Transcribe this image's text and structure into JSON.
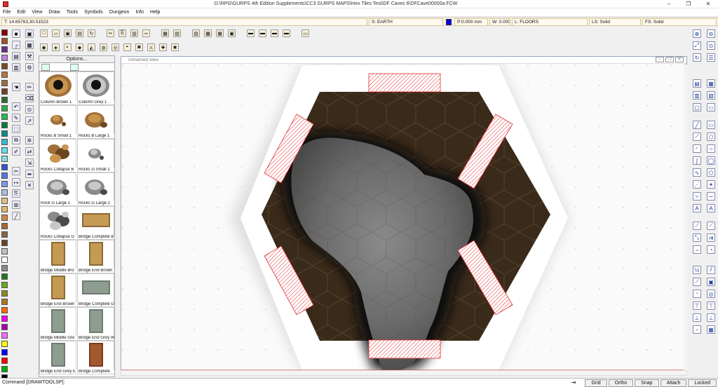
{
  "window": {
    "title": "D:\\RPG\\GURPS 4th Edition Supplements\\CC3 GURPS MAPS\\Hex Tiles Test\\DF Caves 6\\DFCave00000a.FCW",
    "controls": [
      "–",
      "❐",
      "✕"
    ]
  },
  "menu": [
    "File",
    "Edit",
    "View",
    "Draw",
    "Tools",
    "Symbols",
    "Dungeon",
    "Info",
    "Help"
  ],
  "status": {
    "coords": "T: 14.65763,30.51523",
    "sheet": "S: EARTH",
    "pen": "P:0.000 mm",
    "width": "W: 0.00000",
    "layer": "L: FLOORS",
    "line_style": "LS: Solid",
    "fill_style": "FS: Solid",
    "color": "#0000ff"
  },
  "palette": [
    "#8b0000",
    "#a0522d",
    "#6b2e8a",
    "#c080e0",
    "#7a4a22",
    "#b87340",
    "#9a6a40",
    "#704020",
    "#2e6b2e",
    "#33aa44",
    "#22bb55",
    "#0b7a3a",
    "#0c8a8a",
    "#33bbcc",
    "#66ddee",
    "#88e0e0",
    "#3355cc",
    "#5577dd",
    "#7799ee",
    "#a7c0e0",
    "#e0c080",
    "#ddbb66",
    "#cc8844",
    "#aa6633",
    "#886644",
    "#664422",
    "#c0c0c0",
    "#ffffff",
    "#888888",
    "#1a7a1a",
    "#66aa22",
    "#8a8a22",
    "#aa7722",
    "#ff6600",
    "#ee00ee",
    "#aa00aa",
    "#ff66ff",
    "#ffff00",
    "#0000ff",
    "#ff0000",
    "#00aa00",
    "#000000"
  ],
  "symbols_panel": {
    "options_label": "Options...",
    "items": [
      {
        "label": "Column Brown 1",
        "kind": "column-brown"
      },
      {
        "label": "Column Grey 1",
        "kind": "column-grey"
      },
      {
        "label": "Rocks B Small 1",
        "kind": "rocks-b-small"
      },
      {
        "label": "Rocks B Large 1",
        "kind": "rocks-b-large"
      },
      {
        "label": "Rocks Collapse B",
        "kind": "rocks-collapse-b"
      },
      {
        "label": "Rocks G Small 1",
        "kind": "rocks-g-small"
      },
      {
        "label": "Rock G Large 1",
        "kind": "rocks-g-large"
      },
      {
        "label": "Rocks G Large 2",
        "kind": "rocks-g-large2"
      },
      {
        "label": "Rocks Collapse G",
        "kind": "rocks-collapse-g"
      },
      {
        "label": "Bridge Complete B",
        "kind": "bridge-complete-brown"
      },
      {
        "label": "Bridge Middle Bro",
        "kind": "bridge-middle-brown"
      },
      {
        "label": "Bridge End Brown",
        "kind": "bridge-end-brown"
      },
      {
        "label": "Bridge End Brown",
        "kind": "bridge-end-brown2"
      },
      {
        "label": "Bridge Complete G",
        "kind": "bridge-complete-grey"
      },
      {
        "label": "Bridge Middle Gre",
        "kind": "bridge-middle-grey"
      },
      {
        "label": "Bridge End Grey W",
        "kind": "bridge-end-grey"
      },
      {
        "label": "Bridge End Grey E",
        "kind": "bridge-end-grey2"
      },
      {
        "label": "Bridge Complete",
        "kind": "bridge-wood"
      }
    ]
  },
  "view": {
    "title": "Unnamed view"
  },
  "command": {
    "text": "Command [DRAWTOOLSP]:"
  },
  "mode_buttons": [
    "Grid",
    "Ortho",
    "Snap",
    "Attach",
    "Locked"
  ]
}
